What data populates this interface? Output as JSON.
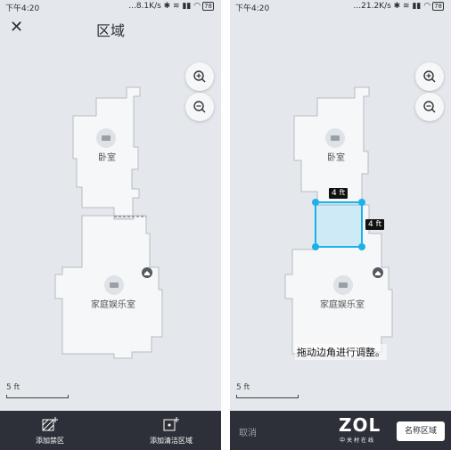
{
  "left_screen": {
    "status": {
      "time": "下午4:20",
      "network": "...8.1K/s ✱ ≋ ▮▮ ◠",
      "battery": "78"
    },
    "title": "区域",
    "rooms": [
      "卧室",
      "家庭娱乐室"
    ],
    "scale_label": "5 ft",
    "bottom": {
      "add_forbidden": "添加禁区",
      "add_clean": "添加清洁区域"
    }
  },
  "right_screen": {
    "status": {
      "time": "下午4:20",
      "network": "...21.2K/s ✱ ≋ ▮▮ ◠",
      "battery": "78"
    },
    "rooms": [
      "卧室",
      "家庭娱乐室"
    ],
    "dim_top": "4 ft",
    "dim_side": "4 ft",
    "hint": "拖动边角进行调整。",
    "scale_label": "5 ft",
    "bottom": {
      "cancel": "取消",
      "name_area": "名称区域",
      "watermark": "ZOL",
      "watermark_sub": "中关村在线"
    }
  },
  "colors": {
    "map_fill": "#f6f7f9",
    "map_border": "#b7bcc3",
    "selection": "#1cb2e8",
    "bottom_bar": "#2d3038"
  },
  "icons": [
    "close-icon",
    "zoom-in-icon",
    "zoom-out-icon",
    "room-icon",
    "home-icon",
    "forbidden-zone-icon",
    "clean-zone-icon"
  ]
}
